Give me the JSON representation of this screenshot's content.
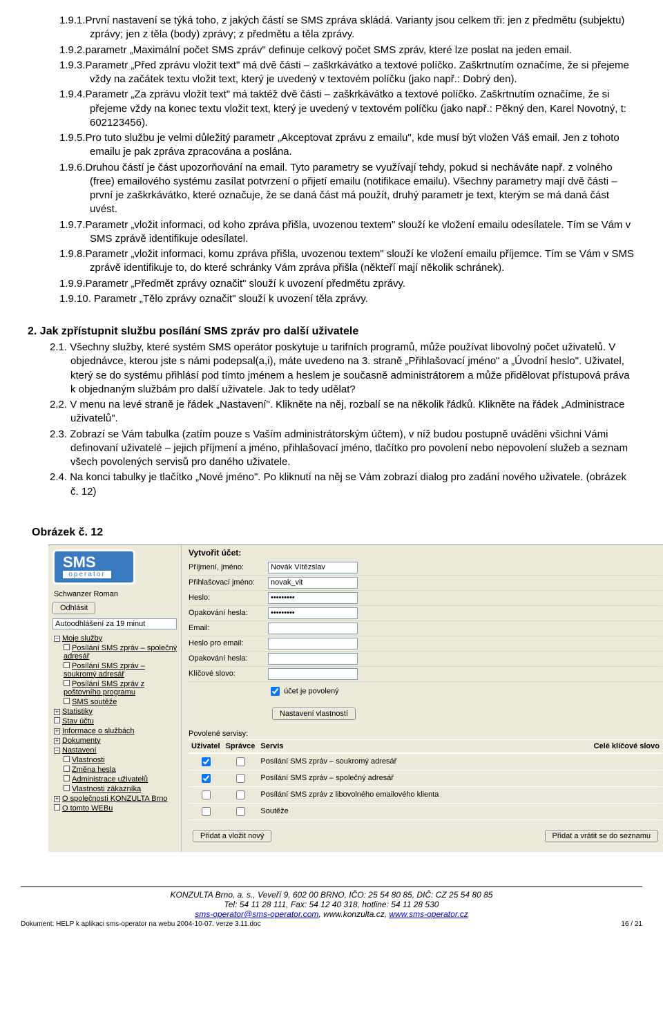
{
  "section1": {
    "items": [
      {
        "num": "1.9.1.",
        "text": "První nastavení se týká toho, z jakých částí se SMS zpráva skládá. Varianty jsou celkem tři: jen z předmětu (subjektu) zprávy; jen z těla (body) zprávy; z předmětu a těla zprávy."
      },
      {
        "num": "1.9.2.",
        "text": "parametr „Maximální počet SMS zpráv\" definuje celkový počet SMS zpráv, které lze poslat na jeden email."
      },
      {
        "num": "1.9.3.",
        "text": "Parametr „Před zprávu vložit text\" má dvě části – zaškrkávátko a textové políčko. Zaškrtnutím označíme, že si přejeme vždy na začátek textu vložit text, který je uvedený v textovém políčku (jako např.: Dobrý den)."
      },
      {
        "num": "1.9.4.",
        "text": "Parametr „Za zprávu vložit text\" má taktéž dvě části – zaškrkávátko a textové políčko. Zaškrtnutím označíme, že si přejeme vždy na konec textu vložit text, který je uvedený v textovém políčku (jako např.: Pěkný den, Karel Novotný, t: 602123456)."
      },
      {
        "num": "1.9.5.",
        "text": "Pro tuto službu je velmi důležitý parametr „Akceptovat zprávu z emailu\", kde musí být vložen Váš email. Jen z tohoto emailu je pak zpráva zpracována a poslána."
      },
      {
        "num": "1.9.6.",
        "text": "Druhou částí je část upozorňování na email. Tyto parametry se využívají tehdy, pokud si necháváte např. z volného (free) emailového systému zasílat potvrzení o přijetí emailu (notifikace emailu). Všechny parametry mají dvě části – první je zaškrkávátko, které označuje, že se daná část má použít, druhý parametr je text, kterým se má daná část uvést."
      },
      {
        "num": "1.9.7.",
        "text": "Parametr „vložit informaci, od koho zpráva přišla, uvozenou textem\" slouží ke vložení emailu odesílatele. Tím se Vám v SMS zprávě identifikuje odesílatel."
      },
      {
        "num": "1.9.8.",
        "text": "Parametr „vložit informaci, komu zpráva přišla, uvozenou textem\" slouží ke vložení emailu příjemce. Tím se Vám v SMS zprávě identifikuje to, do které schránky Vám zpráva přišla (někteří mají několik schránek)."
      },
      {
        "num": "1.9.9.",
        "text": "Parametr „Předmět zprávy označit\" slouží k uvození předmětu zprávy."
      },
      {
        "num": "1.9.10.",
        "text": " Parametr „Tělo zprávy označit\" slouží k uvození těla zprávy."
      }
    ]
  },
  "section2": {
    "heading": "2.   Jak zpřístupnit službu posílání SMS zpráv pro další uživatele",
    "items": [
      {
        "num": "2.1.",
        "text": " Všechny služby, které systém SMS operátor poskytuje u tarifních programů, může používat libovolný  počet uživatelů. V objednávce, kterou jste s námi podepsal(a,i), máte uvedeno na 3. straně „Přihlašovací jméno\" a „Úvodní heslo\". Uživatel, který se do systému přihlásí pod tímto jménem a heslem je současně administrátorem a může přidělovat přístupová práva k objednaným službám pro další uživatele. Jak to tedy udělat?"
      },
      {
        "num": "2.2.",
        "text": " V menu na levé straně je řádek „Nastavení\". Klikněte na něj, rozbalí se na několik řádků. Klikněte na řádek „Administrace uživatelů\"."
      },
      {
        "num": "2.3.",
        "text": " Zobrazí se Vám tabulka (zatím pouze s Vaším administrátorským účtem), v níž budou postupně uváděni všichni Vámi definovaní uživatelé – jejich příjmení a jméno, přihlašovací jméno, tlačítko pro povolení nebo nepovolení služeb a seznam všech povolených servisů pro daného uživatele."
      },
      {
        "num": "2.4.",
        "text": " Na konci tabulky je tlačítko „Nové jméno\". Po kliknutí na něj se Vám zobrazí dialog pro zadání nového uživatele.  (obrázek č. 12)"
      }
    ]
  },
  "imageLabel": "Obrázek č. 12",
  "ui": {
    "logo_top": "SMS",
    "logo_sub": "operator",
    "username": "Schwanzer Roman",
    "logout_btn": "Odhlásit",
    "autolabel": "Autoodhlášení za 19 minut",
    "nav": {
      "grp1_label": "Moje služby",
      "grp1_items": [
        "Posílání SMS zpráv – společný adresář",
        "Posílání SMS zpráv – soukromý adresář",
        "Posílání SMS zpráv z poštovního programu",
        "SMS soutěže"
      ],
      "others": [
        {
          "sq": "+",
          "t": "Statistiky"
        },
        {
          "sq": "",
          "t": "Stav účtu"
        },
        {
          "sq": "+",
          "t": "Informace o službách"
        },
        {
          "sq": "+",
          "t": "Dokumenty"
        },
        {
          "sq": "−",
          "t": "Nastavení"
        }
      ],
      "nastaveni_items": [
        "Vlastnosti",
        "Změna hesla",
        "Administrace uživatelů",
        "Vlastnosti zákazníka"
      ],
      "tail": [
        {
          "sq": "+",
          "t": "O společnosti KONZULTA Brno"
        },
        {
          "sq": "",
          "t": "O tomto WEBu"
        }
      ]
    },
    "form": {
      "title": "Vytvořit účet:",
      "rows": [
        {
          "lbl": "Příjmení, jméno:",
          "val": "Novák Vítězslav",
          "type": "text"
        },
        {
          "lbl": "Přihlašovací jméno:",
          "val": "novak_vit",
          "type": "text"
        },
        {
          "lbl": "Heslo:",
          "val": "*********",
          "type": "password"
        },
        {
          "lbl": "Opakování hesla:",
          "val": "*********",
          "type": "password"
        },
        {
          "lbl": "Email:",
          "val": "",
          "type": "text"
        },
        {
          "lbl": "Heslo pro email:",
          "val": "",
          "type": "password"
        },
        {
          "lbl": "Opakování hesla:",
          "val": "",
          "type": "password"
        },
        {
          "lbl": "Klíčové slovo:",
          "val": "",
          "type": "text"
        }
      ],
      "chk_label": "účet je povolený",
      "btn_vlast": "Nastavení vlastností",
      "subhead": "Povolené servisy:",
      "table_head": {
        "c1": "Uživatel",
        "c2": "Správce",
        "c3": "Servis",
        "c4": "Celé klíčové slovo"
      },
      "table_rows": [
        {
          "u": true,
          "s": false,
          "label": "Posílání SMS zpráv – soukromý adresář"
        },
        {
          "u": true,
          "s": false,
          "label": "Posílání SMS zpráv – společný adresář"
        },
        {
          "u": false,
          "s": false,
          "label": "Posílání SMS zpráv z libovolného emailového klienta"
        },
        {
          "u": false,
          "s": false,
          "label": "Soutěže"
        }
      ],
      "btn_add": "Přidat a vložit nový",
      "btn_back": "Přidat a vrátit se do seznamu"
    }
  },
  "footer": {
    "l1": "KONZULTA Brno, a. s., Veveří 9, 602 00 BRNO, IČO: 25 54 80 85, DIČ: CZ 25 54 80 85",
    "l2": "Tel: 54 11 28 111, Fax: 54 12 40 318, hotline: 54 11 28 530",
    "l3_a": "sms-operator@sms-operator.com",
    "l3_b": ", www.konzulta.cz, ",
    "l3_c": "www.sms-operator.cz",
    "docleft": "Dokument: HELP k aplikaci sms-operator na webu 2004-10-07. verze 3.11.doc",
    "docright": "16 / 21"
  }
}
